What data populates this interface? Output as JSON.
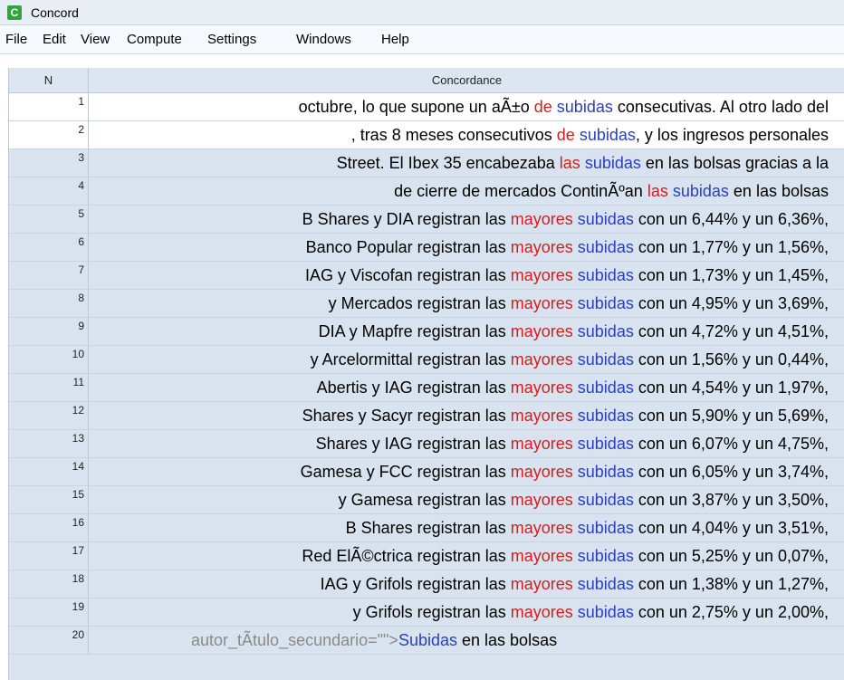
{
  "app": {
    "title": "Concord",
    "icon_glyph": "C",
    "icon_color": "#34a23d"
  },
  "menu": [
    "File",
    "Edit",
    "View",
    "Compute",
    "Settings",
    "Windows",
    "Help"
  ],
  "table": {
    "headers": {
      "n": "N",
      "concordance": "Concordance"
    },
    "rows": [
      {
        "n": "1",
        "left": "octubre, lo que supone un aÃ±o",
        "coll": "de",
        "node": "subidas",
        "right": "consecutivas. Al otro lado del"
      },
      {
        "n": "2",
        "left": ", tras 8 meses consecutivos",
        "coll": "de",
        "node": "subidas",
        "right": ", y los ingresos personales"
      },
      {
        "n": "3",
        "left": "Street. El Ibex 35 encabezaba",
        "coll": "las",
        "node": "subidas",
        "right": "en las bolsas gracias a la"
      },
      {
        "n": "4",
        "left": "de cierre de mercados ContinÃºan",
        "coll": "las",
        "node": "subidas",
        "right": "en las bolsas"
      },
      {
        "n": "5",
        "left": "B Shares y DIA registran las",
        "coll": "mayores",
        "node": "subidas",
        "right": "con un 6,44% y un 6,36%,"
      },
      {
        "n": "6",
        "left": "Banco Popular registran las",
        "coll": "mayores",
        "node": "subidas",
        "right": "con un 1,77% y un 1,56%,"
      },
      {
        "n": "7",
        "left": "IAG y Viscofan registran las",
        "coll": "mayores",
        "node": "subidas",
        "right": "con un 1,73% y un 1,45%,"
      },
      {
        "n": "8",
        "left": "y Mercados registran las",
        "coll": "mayores",
        "node": "subidas",
        "right": "con un 4,95% y un 3,69%,"
      },
      {
        "n": "9",
        "left": "DIA y Mapfre registran las",
        "coll": "mayores",
        "node": "subidas",
        "right": "con un 4,72% y un 4,51%,"
      },
      {
        "n": "10",
        "left": "y Arcelormittal registran las",
        "coll": "mayores",
        "node": "subidas",
        "right": "con un 1,56% y un 0,44%,"
      },
      {
        "n": "11",
        "left": "Abertis y IAG registran las",
        "coll": "mayores",
        "node": "subidas",
        "right": "con un 4,54% y un 1,97%,"
      },
      {
        "n": "12",
        "left": "Shares y Sacyr registran las",
        "coll": "mayores",
        "node": "subidas",
        "right": "con un 5,90% y un 5,69%,"
      },
      {
        "n": "13",
        "left": "Shares y IAG registran las",
        "coll": "mayores",
        "node": "subidas",
        "right": "con un 6,07% y un 4,75%,"
      },
      {
        "n": "14",
        "left": "Gamesa y FCC registran las",
        "coll": "mayores",
        "node": "subidas",
        "right": "con un 6,05% y un 3,74%,"
      },
      {
        "n": "15",
        "left": "y Gamesa registran las",
        "coll": "mayores",
        "node": "subidas",
        "right": "con un 3,87% y un 3,50%,"
      },
      {
        "n": "16",
        "left": "B Shares registran las",
        "coll": "mayores",
        "node": "subidas",
        "right": "con un 4,04% y un 3,51%,"
      },
      {
        "n": "17",
        "left": "Red ElÃ©ctrica registran las",
        "coll": "mayores",
        "node": "subidas",
        "right": "con un 5,25% y un 0,07%,"
      },
      {
        "n": "18",
        "left": "IAG y Grifols registran las",
        "coll": "mayores",
        "node": "subidas",
        "right": "con un 1,38% y un 1,27%,"
      },
      {
        "n": "19",
        "left": "y Grifols registran las",
        "coll": "mayores",
        "node": "subidas",
        "right": "con un 2,75% y un 2,00%,"
      },
      {
        "n": "20",
        "left": "autor_tÃ­tulo_secundario=\"\">",
        "coll": "",
        "node": "Subidas",
        "right": "en las bolsas"
      }
    ]
  },
  "colors": {
    "node": "#2a3fbf",
    "collocate": "#d11f1f",
    "markup": "#8a8a8a",
    "grid_bg": "#d8e3ef",
    "highlight_bg": "#ffffff"
  }
}
